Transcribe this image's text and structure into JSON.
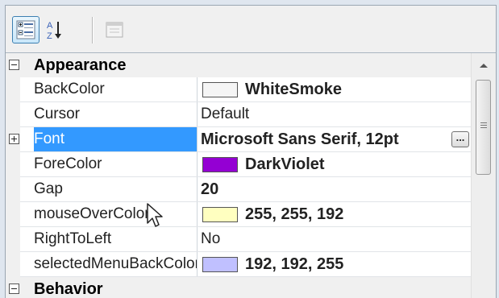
{
  "toolbar": {
    "buttons": [
      {
        "name": "categorized-view-button",
        "icon": "categorized-icon",
        "active": true
      },
      {
        "name": "alphabetical-sort-button",
        "icon": "sort-az-icon",
        "active": false
      },
      {
        "name": "property-pages-button",
        "icon": "property-pages-icon",
        "active": false,
        "disabled": true
      }
    ]
  },
  "grid": {
    "category": "Appearance",
    "next_category_partial": "Behavior",
    "properties": [
      {
        "name": "BackColor",
        "value": "WhiteSmoke",
        "swatch": "#f5f5f5",
        "bold": true
      },
      {
        "name": "Cursor",
        "value": "Default",
        "bold": false
      },
      {
        "name": "Font",
        "value": "Microsoft Sans Serif, 12pt",
        "bold": true,
        "selected": true,
        "expandable": true,
        "ellipsis": "..."
      },
      {
        "name": "ForeColor",
        "value": "DarkViolet",
        "swatch": "#9400d3",
        "bold": true
      },
      {
        "name": "Gap",
        "value": "20",
        "bold": true
      },
      {
        "name": "mouseOverColor",
        "value": "255, 255, 192",
        "swatch": "#ffffc0",
        "bold": true
      },
      {
        "name": "RightToLeft",
        "value": "No",
        "bold": false
      },
      {
        "name": "selectedMenuBackColor",
        "value": "192, 192, 255",
        "swatch": "#c0c0ff",
        "bold": true
      }
    ]
  },
  "colors": {
    "selection": "#3399ff",
    "category_bg": "#f0f0f0"
  }
}
